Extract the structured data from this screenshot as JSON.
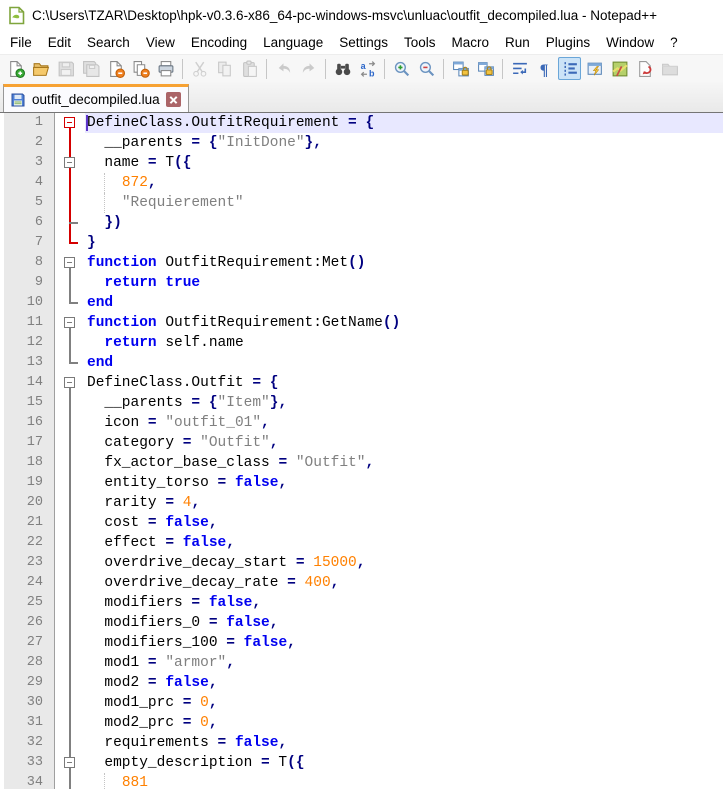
{
  "title": "C:\\Users\\TZAR\\Desktop\\hpk-v0.3.6-x86_64-pc-windows-msvc\\unluac\\outfit_decompiled.lua - Notepad++",
  "icons": {
    "app": "notepadpp-document-icon",
    "tab_file_state": "saved-floppy-icon",
    "tab_close": "close-x-icon"
  },
  "menu": {
    "items": [
      "File",
      "Edit",
      "Search",
      "View",
      "Encoding",
      "Language",
      "Settings",
      "Tools",
      "Macro",
      "Run",
      "Plugins",
      "Window",
      "?"
    ]
  },
  "toolbar": {
    "items": [
      {
        "name": "new-file",
        "state": "normal"
      },
      {
        "name": "open",
        "state": "normal"
      },
      {
        "name": "save",
        "state": "disabled"
      },
      {
        "name": "save-all",
        "state": "disabled"
      },
      {
        "name": "close",
        "state": "normal"
      },
      {
        "name": "close-all",
        "state": "normal"
      },
      {
        "name": "print",
        "state": "normal"
      },
      {
        "name": "sep"
      },
      {
        "name": "cut",
        "state": "disabled"
      },
      {
        "name": "copy",
        "state": "disabled"
      },
      {
        "name": "paste",
        "state": "disabled"
      },
      {
        "name": "sep"
      },
      {
        "name": "undo",
        "state": "disabled"
      },
      {
        "name": "redo",
        "state": "disabled"
      },
      {
        "name": "sep"
      },
      {
        "name": "find",
        "state": "normal"
      },
      {
        "name": "replace",
        "state": "normal"
      },
      {
        "name": "sep"
      },
      {
        "name": "zoom-in",
        "state": "normal"
      },
      {
        "name": "zoom-out",
        "state": "normal"
      },
      {
        "name": "sep"
      },
      {
        "name": "sync-vertical",
        "state": "normal"
      },
      {
        "name": "sync-horizontal",
        "state": "normal"
      },
      {
        "name": "sep"
      },
      {
        "name": "word-wrap",
        "state": "normal"
      },
      {
        "name": "show-all-characters",
        "state": "normal"
      },
      {
        "name": "indent-guide",
        "state": "active"
      },
      {
        "name": "function-list",
        "state": "normal"
      },
      {
        "name": "document-map",
        "state": "normal"
      },
      {
        "name": "macro-record",
        "state": "normal"
      },
      {
        "name": "monitoring",
        "state": "disabled"
      }
    ]
  },
  "tab": {
    "label": "outfit_decompiled.lua"
  },
  "colors": {
    "accent": "#f7a233",
    "keyword": "#0000f0",
    "operator": "#000080",
    "string": "#808080",
    "number": "#ff8000",
    "fold-active": "#d40000",
    "fold-normal": "#808080",
    "current-line": "#e8e8ff",
    "gutter-bg": "#e9e9e9",
    "gutter-text": "#808080",
    "caret": "#5e35c9"
  },
  "code": {
    "language": "Lua",
    "lines": [
      {
        "n": 1,
        "hl": true,
        "caret": true,
        "fold": "boxR",
        "tokens": [
          [
            "p",
            "DefineClass.OutfitRequirement "
          ],
          [
            "o",
            "="
          ],
          [
            "p",
            " "
          ],
          [
            "o",
            "{"
          ]
        ]
      },
      {
        "n": 2,
        "fold": "lineR",
        "tokens": [
          [
            "p",
            "  __parents "
          ],
          [
            "o",
            "="
          ],
          [
            "p",
            " "
          ],
          [
            "o",
            "{"
          ],
          [
            "s",
            "\"InitDone\""
          ],
          [
            "o",
            "},"
          ]
        ]
      },
      {
        "n": 3,
        "fold": "boxG_midR",
        "tokens": [
          [
            "p",
            "  name "
          ],
          [
            "o",
            "="
          ],
          [
            "p",
            " T"
          ],
          [
            "o",
            "({"
          ]
        ]
      },
      {
        "n": 4,
        "fold": "lineR",
        "guide": true,
        "tokens": [
          [
            "p",
            "    "
          ],
          [
            "n",
            "872"
          ],
          [
            "o",
            ","
          ]
        ]
      },
      {
        "n": 5,
        "fold": "lineR",
        "guide": true,
        "tokens": [
          [
            "p",
            "    "
          ],
          [
            "s",
            "\"Requierement\""
          ]
        ]
      },
      {
        "n": 6,
        "fold": "lineR_tick",
        "tokens": [
          [
            "p",
            "  "
          ],
          [
            "o",
            "})"
          ]
        ]
      },
      {
        "n": 7,
        "fold": "endR",
        "tokens": [
          [
            "o",
            "}"
          ]
        ]
      },
      {
        "n": 8,
        "fold": "boxG",
        "tokens": [
          [
            "k",
            "function"
          ],
          [
            "p",
            " OutfitRequirement:Met"
          ],
          [
            "o",
            "()"
          ]
        ]
      },
      {
        "n": 9,
        "fold": "lineG",
        "tokens": [
          [
            "p",
            "  "
          ],
          [
            "k",
            "return"
          ],
          [
            "p",
            " "
          ],
          [
            "k",
            "true"
          ]
        ]
      },
      {
        "n": 10,
        "fold": "endG",
        "tokens": [
          [
            "k",
            "end"
          ]
        ]
      },
      {
        "n": 11,
        "fold": "boxG",
        "tokens": [
          [
            "k",
            "function"
          ],
          [
            "p",
            " OutfitRequirement:GetName"
          ],
          [
            "o",
            "()"
          ]
        ]
      },
      {
        "n": 12,
        "fold": "lineG",
        "tokens": [
          [
            "p",
            "  "
          ],
          [
            "k",
            "return"
          ],
          [
            "p",
            " self.name"
          ]
        ]
      },
      {
        "n": 13,
        "fold": "endG",
        "tokens": [
          [
            "k",
            "end"
          ]
        ]
      },
      {
        "n": 14,
        "fold": "boxG",
        "tokens": [
          [
            "p",
            "DefineClass.Outfit "
          ],
          [
            "o",
            "="
          ],
          [
            "p",
            " "
          ],
          [
            "o",
            "{"
          ]
        ]
      },
      {
        "n": 15,
        "fold": "lineG",
        "tokens": [
          [
            "p",
            "  __parents "
          ],
          [
            "o",
            "="
          ],
          [
            "p",
            " "
          ],
          [
            "o",
            "{"
          ],
          [
            "s",
            "\"Item\""
          ],
          [
            "o",
            "},"
          ]
        ]
      },
      {
        "n": 16,
        "fold": "lineG",
        "tokens": [
          [
            "p",
            "  icon "
          ],
          [
            "o",
            "="
          ],
          [
            "p",
            " "
          ],
          [
            "s",
            "\"outfit_01\""
          ],
          [
            "o",
            ","
          ]
        ]
      },
      {
        "n": 17,
        "fold": "lineG",
        "tokens": [
          [
            "p",
            "  category "
          ],
          [
            "o",
            "="
          ],
          [
            "p",
            " "
          ],
          [
            "s",
            "\"Outfit\""
          ],
          [
            "o",
            ","
          ]
        ]
      },
      {
        "n": 18,
        "fold": "lineG",
        "tokens": [
          [
            "p",
            "  fx_actor_base_class "
          ],
          [
            "o",
            "="
          ],
          [
            "p",
            " "
          ],
          [
            "s",
            "\"Outfit\""
          ],
          [
            "o",
            ","
          ]
        ]
      },
      {
        "n": 19,
        "fold": "lineG",
        "tokens": [
          [
            "p",
            "  entity_torso "
          ],
          [
            "o",
            "="
          ],
          [
            "p",
            " "
          ],
          [
            "k",
            "false"
          ],
          [
            "o",
            ","
          ]
        ]
      },
      {
        "n": 20,
        "fold": "lineG",
        "tokens": [
          [
            "p",
            "  rarity "
          ],
          [
            "o",
            "="
          ],
          [
            "p",
            " "
          ],
          [
            "n",
            "4"
          ],
          [
            "o",
            ","
          ]
        ]
      },
      {
        "n": 21,
        "fold": "lineG",
        "tokens": [
          [
            "p",
            "  cost "
          ],
          [
            "o",
            "="
          ],
          [
            "p",
            " "
          ],
          [
            "k",
            "false"
          ],
          [
            "o",
            ","
          ]
        ]
      },
      {
        "n": 22,
        "fold": "lineG",
        "tokens": [
          [
            "p",
            "  effect "
          ],
          [
            "o",
            "="
          ],
          [
            "p",
            " "
          ],
          [
            "k",
            "false"
          ],
          [
            "o",
            ","
          ]
        ]
      },
      {
        "n": 23,
        "fold": "lineG",
        "tokens": [
          [
            "p",
            "  overdrive_decay_start "
          ],
          [
            "o",
            "="
          ],
          [
            "p",
            " "
          ],
          [
            "n",
            "15000"
          ],
          [
            "o",
            ","
          ]
        ]
      },
      {
        "n": 24,
        "fold": "lineG",
        "tokens": [
          [
            "p",
            "  overdrive_decay_rate "
          ],
          [
            "o",
            "="
          ],
          [
            "p",
            " "
          ],
          [
            "n",
            "400"
          ],
          [
            "o",
            ","
          ]
        ]
      },
      {
        "n": 25,
        "fold": "lineG",
        "tokens": [
          [
            "p",
            "  modifiers "
          ],
          [
            "o",
            "="
          ],
          [
            "p",
            " "
          ],
          [
            "k",
            "false"
          ],
          [
            "o",
            ","
          ]
        ]
      },
      {
        "n": 26,
        "fold": "lineG",
        "tokens": [
          [
            "p",
            "  modifiers_0 "
          ],
          [
            "o",
            "="
          ],
          [
            "p",
            " "
          ],
          [
            "k",
            "false"
          ],
          [
            "o",
            ","
          ]
        ]
      },
      {
        "n": 27,
        "fold": "lineG",
        "tokens": [
          [
            "p",
            "  modifiers_100 "
          ],
          [
            "o",
            "="
          ],
          [
            "p",
            " "
          ],
          [
            "k",
            "false"
          ],
          [
            "o",
            ","
          ]
        ]
      },
      {
        "n": 28,
        "fold": "lineG",
        "tokens": [
          [
            "p",
            "  mod1 "
          ],
          [
            "o",
            "="
          ],
          [
            "p",
            " "
          ],
          [
            "s",
            "\"armor\""
          ],
          [
            "o",
            ","
          ]
        ]
      },
      {
        "n": 29,
        "fold": "lineG",
        "tokens": [
          [
            "p",
            "  mod2 "
          ],
          [
            "o",
            "="
          ],
          [
            "p",
            " "
          ],
          [
            "k",
            "false"
          ],
          [
            "o",
            ","
          ]
        ]
      },
      {
        "n": 30,
        "fold": "lineG",
        "tokens": [
          [
            "p",
            "  mod1_prc "
          ],
          [
            "o",
            "="
          ],
          [
            "p",
            " "
          ],
          [
            "n",
            "0"
          ],
          [
            "o",
            ","
          ]
        ]
      },
      {
        "n": 31,
        "fold": "lineG",
        "tokens": [
          [
            "p",
            "  mod2_prc "
          ],
          [
            "o",
            "="
          ],
          [
            "p",
            " "
          ],
          [
            "n",
            "0"
          ],
          [
            "o",
            ","
          ]
        ]
      },
      {
        "n": 32,
        "fold": "lineG",
        "tokens": [
          [
            "p",
            "  requirements "
          ],
          [
            "o",
            "="
          ],
          [
            "p",
            " "
          ],
          [
            "k",
            "false"
          ],
          [
            "o",
            ","
          ]
        ]
      },
      {
        "n": 33,
        "fold": "boxG_midG",
        "tokens": [
          [
            "p",
            "  empty_description "
          ],
          [
            "o",
            "="
          ],
          [
            "p",
            " T"
          ],
          [
            "o",
            "({"
          ]
        ]
      },
      {
        "n": 34,
        "fold": "lineG",
        "guide": true,
        "tokens": [
          [
            "p",
            "    "
          ],
          [
            "n",
            "881"
          ]
        ]
      }
    ]
  }
}
